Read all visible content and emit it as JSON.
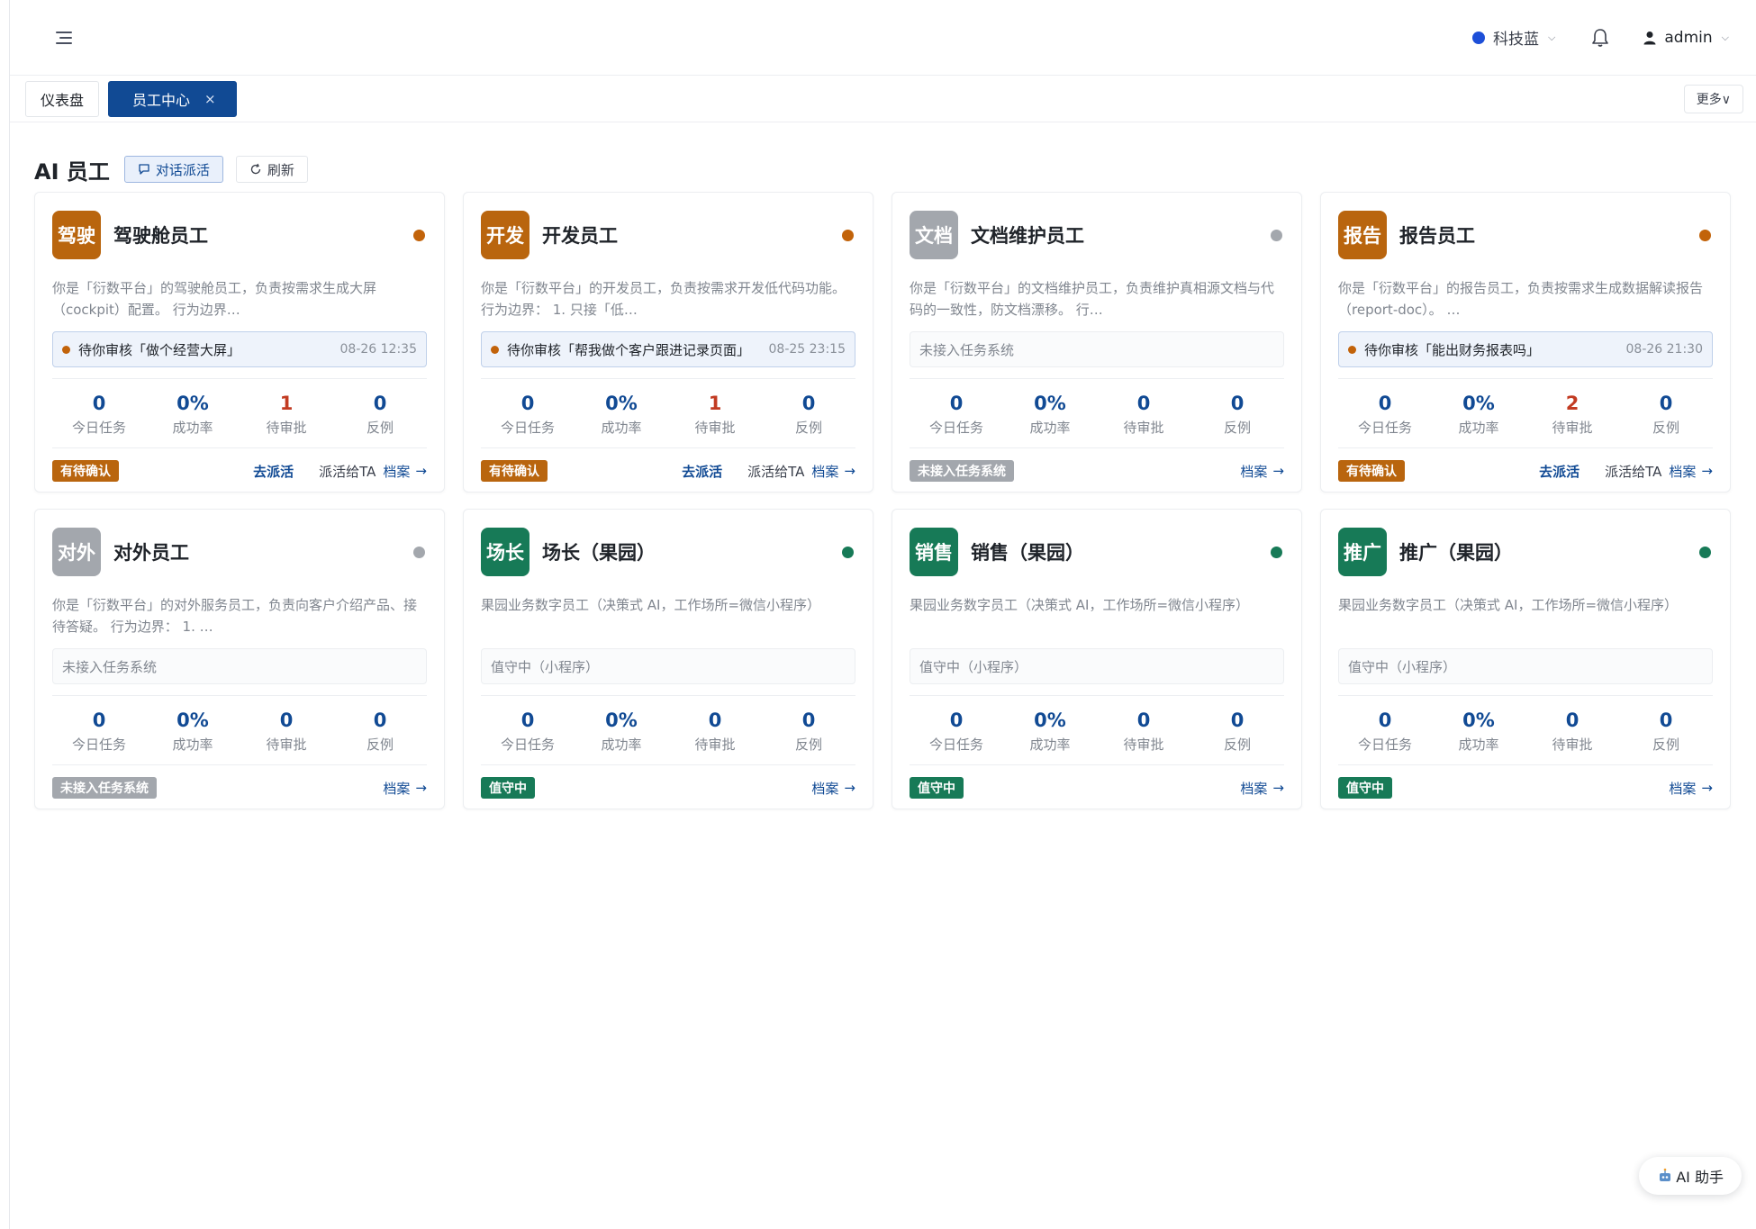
{
  "header": {
    "theme_label": "科技蓝",
    "theme_color": "#1d4fd8",
    "user_label": "admin"
  },
  "tabs": {
    "dashboard": "仪表盘",
    "employee_center": "员工中心",
    "close_glyph": "×",
    "more": "更多∨"
  },
  "page": {
    "title": "AI 员工",
    "dispatch_label": "对话派活",
    "refresh_label": "刷新"
  },
  "stat_labels": {
    "today": "今日任务",
    "success": "成功率",
    "pending": "待审批",
    "counter": "反例"
  },
  "actions": {
    "dispatch": "去派活",
    "assign_to": "派活给TA",
    "archive": "档案",
    "arrow": "→"
  },
  "colors": {
    "orange": "#b9650e",
    "gray": "#a3a7ad",
    "green": "#177a57",
    "status_orange": "#c2630a",
    "status_gray": "#a3a7ad",
    "status_green": "#177a57"
  },
  "cards": [
    {
      "avatar": "驾驶",
      "avatar_color": "orange",
      "name": "驾驶舱员工",
      "status_color": "status_orange",
      "desc": "你是「衍数平台」的驾驶舱员工，负责按需求生成大屏（cockpit）配置。 行为边界…",
      "task": "待你审核「做个经营大屏」",
      "task_time": "08-26 12:35",
      "task_kind": "pending",
      "stats": {
        "today": "0",
        "success": "0%",
        "pending": "1",
        "counter": "0"
      },
      "pending_red": true,
      "badge": "有待确认",
      "badge_color": "orange",
      "show_dispatch": true
    },
    {
      "avatar": "开发",
      "avatar_color": "orange",
      "name": "开发员工",
      "status_color": "status_orange",
      "desc": "你是「衍数平台」的开发员工，负责按需求开发低代码功能。 行为边界： 1. 只接「低…",
      "task": "待你审核「帮我做个客户跟进记录页面」",
      "task_time": "08-25 23:15",
      "task_kind": "pending",
      "stats": {
        "today": "0",
        "success": "0%",
        "pending": "1",
        "counter": "0"
      },
      "pending_red": true,
      "badge": "有待确认",
      "badge_color": "orange",
      "show_dispatch": true
    },
    {
      "avatar": "文档",
      "avatar_color": "gray",
      "name": "文档维护员工",
      "status_color": "status_gray",
      "desc": "你是「衍数平台」的文档维护员工，负责维护真相源文档与代码的一致性，防文档漂移。 行…",
      "task": "未接入任务系统",
      "task_time": "",
      "task_kind": "plain",
      "stats": {
        "today": "0",
        "success": "0%",
        "pending": "0",
        "counter": "0"
      },
      "pending_red": false,
      "badge": "未接入任务系统",
      "badge_color": "gray",
      "show_dispatch": false
    },
    {
      "avatar": "报告",
      "avatar_color": "orange",
      "name": "报告员工",
      "status_color": "status_orange",
      "desc": "你是「衍数平台」的报告员工，负责按需求生成数据解读报告（report-doc）。 …",
      "task": "待你审核「能出财务报表吗」",
      "task_time": "08-26 21:30",
      "task_kind": "pending",
      "stats": {
        "today": "0",
        "success": "0%",
        "pending": "2",
        "counter": "0"
      },
      "pending_red": true,
      "badge": "有待确认",
      "badge_color": "orange",
      "show_dispatch": true
    },
    {
      "avatar": "对外",
      "avatar_color": "gray",
      "name": "对外员工",
      "status_color": "status_gray",
      "desc": "你是「衍数平台」的对外服务员工，负责向客户介绍产品、接待答疑。 行为边界： 1. …",
      "task": "未接入任务系统",
      "task_time": "",
      "task_kind": "plain",
      "stats": {
        "today": "0",
        "success": "0%",
        "pending": "0",
        "counter": "0"
      },
      "pending_red": false,
      "badge": "未接入任务系统",
      "badge_color": "gray",
      "show_dispatch": false
    },
    {
      "avatar": "场长",
      "avatar_color": "green",
      "name": "场长（果园）",
      "status_color": "status_green",
      "desc": "果园业务数字员工（决策式 AI，工作场所=微信小程序）",
      "task": "值守中（小程序）",
      "task_time": "",
      "task_kind": "plain",
      "stats": {
        "today": "0",
        "success": "0%",
        "pending": "0",
        "counter": "0"
      },
      "pending_red": false,
      "badge": "值守中",
      "badge_color": "green",
      "show_dispatch": false
    },
    {
      "avatar": "销售",
      "avatar_color": "green",
      "name": "销售（果园）",
      "status_color": "status_green",
      "desc": "果园业务数字员工（决策式 AI，工作场所=微信小程序）",
      "task": "值守中（小程序）",
      "task_time": "",
      "task_kind": "plain",
      "stats": {
        "today": "0",
        "success": "0%",
        "pending": "0",
        "counter": "0"
      },
      "pending_red": false,
      "badge": "值守中",
      "badge_color": "green",
      "show_dispatch": false
    },
    {
      "avatar": "推广",
      "avatar_color": "green",
      "name": "推广（果园）",
      "status_color": "status_green",
      "desc": "果园业务数字员工（决策式 AI，工作场所=微信小程序）",
      "task": "值守中（小程序）",
      "task_time": "",
      "task_kind": "plain",
      "stats": {
        "today": "0",
        "success": "0%",
        "pending": "0",
        "counter": "0"
      },
      "pending_red": false,
      "badge": "值守中",
      "badge_color": "green",
      "show_dispatch": false
    }
  ],
  "ai_helper": {
    "label": "AI 助手",
    "icon": "robot-icon"
  }
}
